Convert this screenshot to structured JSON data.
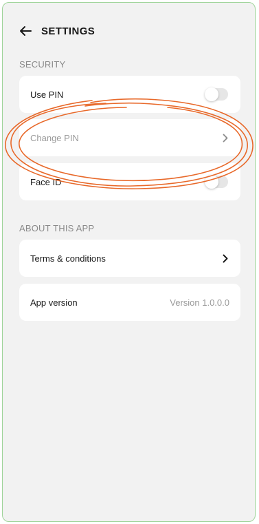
{
  "header": {
    "title": "SETTINGS"
  },
  "sections": {
    "security": {
      "label": "SECURITY",
      "use_pin": {
        "label": "Use PIN",
        "enabled": false
      },
      "change_pin": {
        "label": "Change PIN"
      },
      "face_id": {
        "label": "Face ID",
        "enabled": false
      }
    },
    "about": {
      "label": "ABOUT THIS APP",
      "terms": {
        "label": "Terms & conditions"
      },
      "version": {
        "label": "App version",
        "value": "Version 1.0.0.0"
      }
    }
  },
  "icons": {
    "back": "arrow-left-icon",
    "chevron": "chevron-right-icon"
  },
  "colors": {
    "background": "#f2f2f2",
    "card": "#ffffff",
    "frame_border": "#9fd49a",
    "annotation": "#e8692a",
    "muted_text": "#8a8a8a",
    "toggle_off": "#e6e6e6"
  }
}
